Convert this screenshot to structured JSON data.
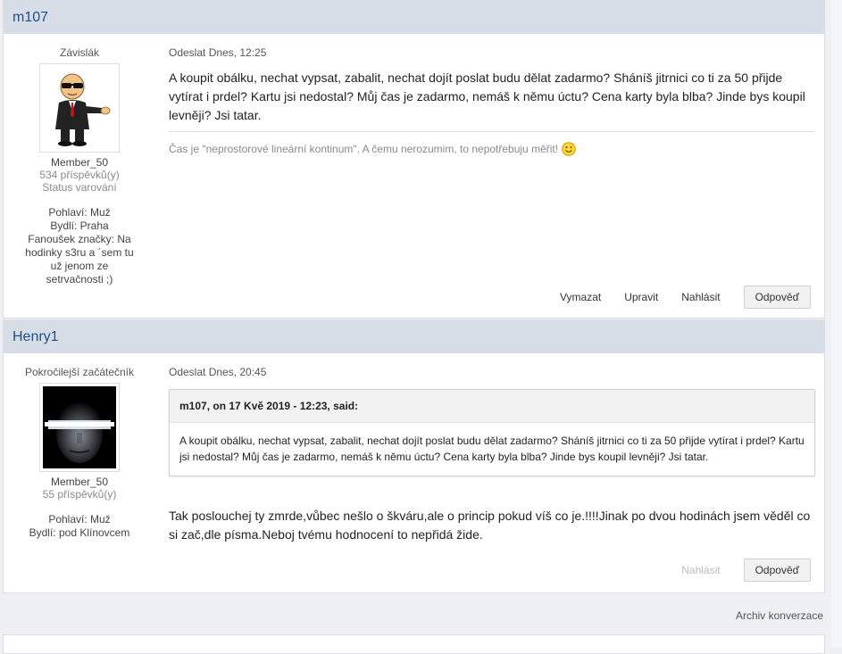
{
  "posts": [
    {
      "author": "m107",
      "rank": "Závislák",
      "group": "Member_50",
      "postcount": "534 příspěvků(y)",
      "warning": "Status varování",
      "fields": {
        "gender": "Pohlaví: Muž",
        "location": "Bydlí: Praha",
        "fan": "Fanoušek značky: Na hodinky s3ru a ´sem tu už jenom ze setrvačnosti ;)"
      },
      "date": "Odeslat Dnes, 12:25",
      "body": "A koupit obálku, nechat vypsat, zabalit, nechat dojít poslat budu dělat zadarmo? Sháníš jitrnici co ti za 50 přijde vytírat i prdel? Kartu jsi nedostal? Můj čas je zadarmo, nemáš k němu úctu? Cena karty byla blba? Jinde bys koupil levněji? Jsi tatar.",
      "signature": "Čas je \"neprostorové lineární kontinum\". A čemu nerozumim, to nepotřebuju měřit!",
      "actions": {
        "delete": "Vymazat",
        "edit": "Upravit",
        "report": "Nahlásit",
        "reply": "Odpověď"
      }
    },
    {
      "author": "Henry1",
      "rank": "Pokročilejší začátečník",
      "group": "Member_50",
      "postcount": "55 příspěvků(y)",
      "fields": {
        "gender": "Pohlaví: Muž",
        "location": "Bydlí: pod Klínovcem"
      },
      "date": "Odeslat Dnes, 20:45",
      "quote": {
        "citation": "m107, on 17 Kvě 2019 - 12:23, said:",
        "text": "A koupit obálku, nechat vypsat, zabalit, nechat dojít poslat budu dělat zadarmo? Sháníš jitrnici co ti za 50 přijde vytírat i prdel? Kartu jsi nedostal? Můj čas je zadarmo, nemáš k němu úctu? Cena karty byla blba? Jinde bys koupil levněji? Jsi tatar."
      },
      "body": "Tak poslouchej ty zmrde,vůbec nešlo o škváru,ale o princip pokud víš co je.!!!!Jinak po dvou hodinách jsem věděl co si zač,dle písma.Neboj tvému hodnocení to nepřidá žide.",
      "actions": {
        "report": "Nahlásit",
        "reply": "Odpověď"
      }
    }
  ],
  "footer": {
    "archive_link": "Archiv konverzace"
  },
  "colors": {
    "header_bg": "#d7dde6",
    "author_link": "#1d4f8a",
    "page_bg": "#eef0f3"
  }
}
